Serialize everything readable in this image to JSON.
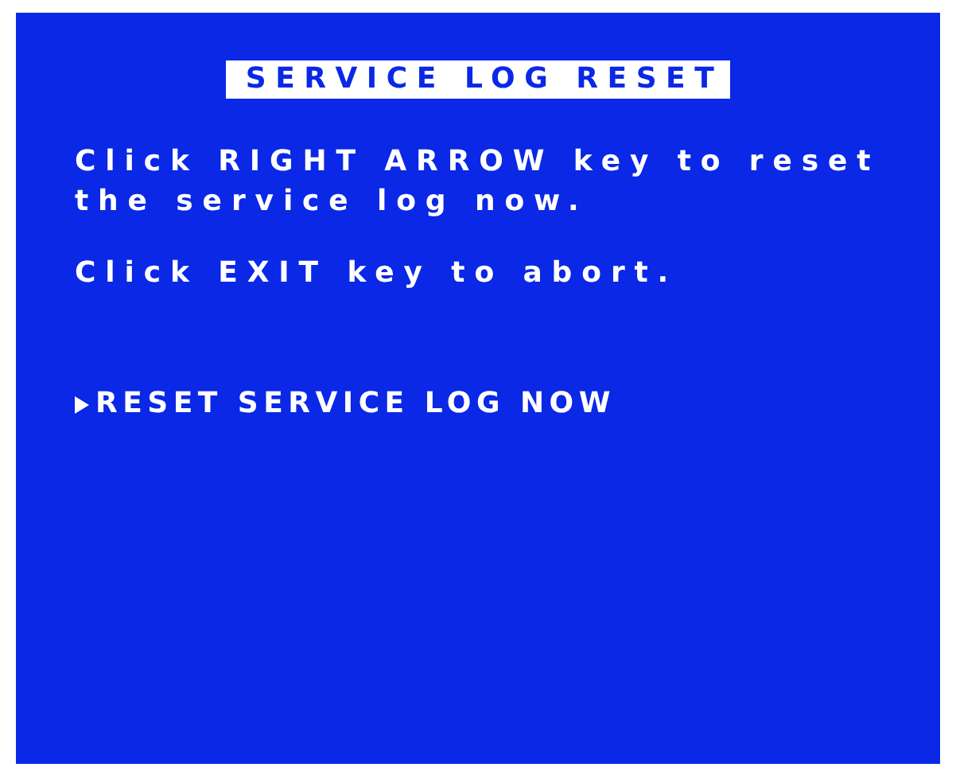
{
  "title": "SERVICE LOG RESET",
  "instructions": [
    {
      "lines": [
        "Click RIGHT ARROW key to reset",
        "the service log now."
      ]
    },
    {
      "lines": [
        "Click EXIT key to abort."
      ]
    }
  ],
  "menu": [
    {
      "label": "RESET SERVICE LOG NOW",
      "selected": true
    }
  ]
}
